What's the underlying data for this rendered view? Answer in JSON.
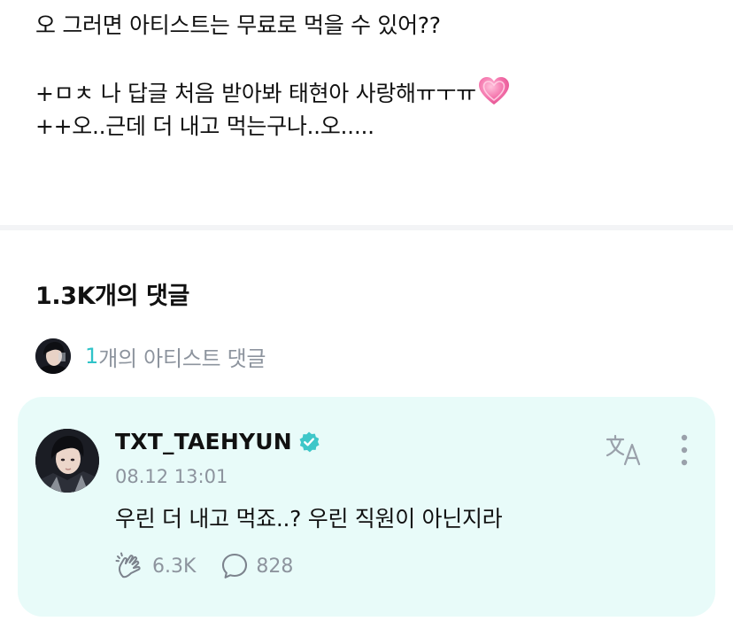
{
  "post": {
    "lines": [
      "오 그러면 아티스트는 무료로 먹을 수 있어??",
      "",
      "+ㅁㅊ 나 답글 처음 받아봐 태현아 사랑해ㅠㅜㅠ",
      "++오..근데 더 내고 먹는구나..오....."
    ],
    "heart_icon": "pink-heart-emoji"
  },
  "comments": {
    "title": "1.3K개의 댓글",
    "artist_count_num": "1",
    "artist_count_label": "개의 아티스트 댓글"
  },
  "artist_comment": {
    "author": "TXT_TAEHYUN",
    "verified_icon": "verified-badge-icon",
    "time": "08.12 13:01",
    "text": "우린 더 내고 먹죠..? 우린 직원이 아닌지라",
    "likes": "6.3K",
    "replies": "828",
    "translate_icon": "translate-icon",
    "more_icon": "more-vertical-icon",
    "like_icon": "cheer-hand-icon",
    "reply_icon": "speech-bubble-icon"
  },
  "colors": {
    "accent": "#2fc3c8",
    "card_bg": "#e8fbf9",
    "muted": "#8d949e",
    "verified": "#3ec7c9",
    "heart": "#f06fa6"
  }
}
